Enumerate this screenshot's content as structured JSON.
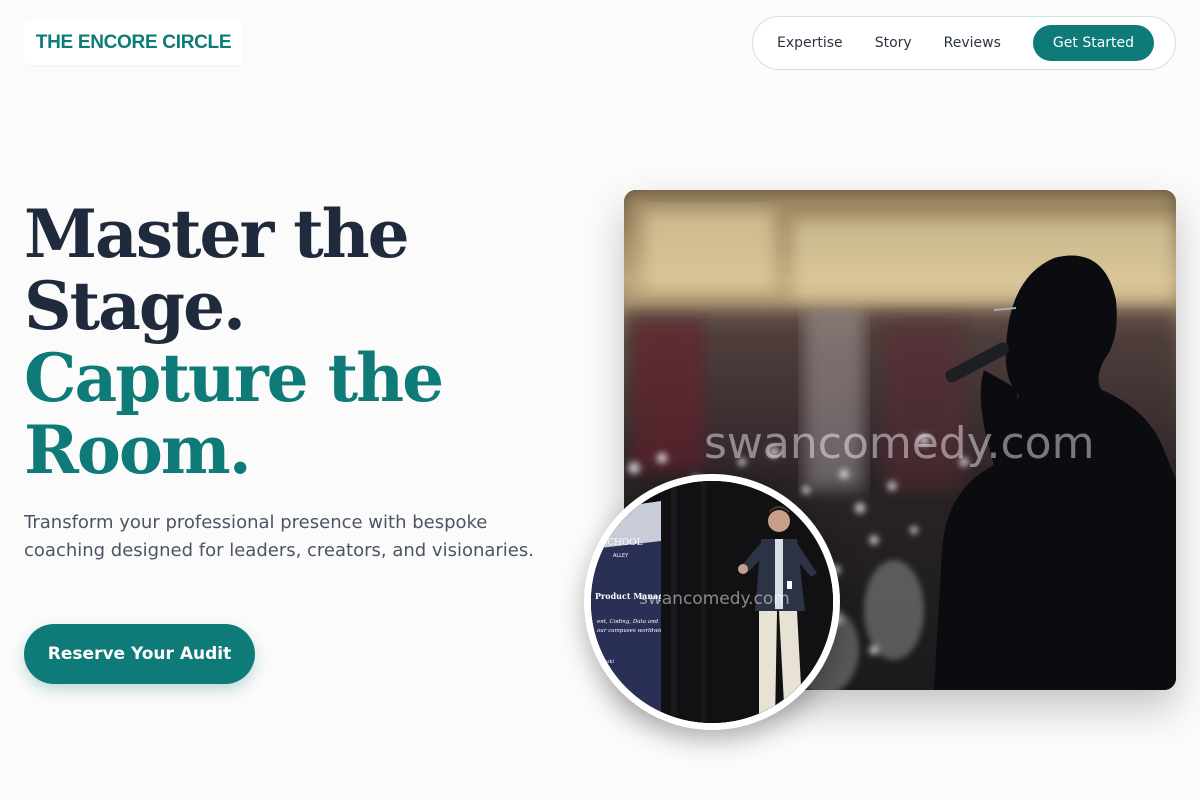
{
  "header": {
    "logo_text": "THE ENCORE CIRCLE",
    "nav": {
      "links": [
        "Expertise",
        "Story",
        "Reviews"
      ],
      "cta_label": "Get Started"
    }
  },
  "hero": {
    "headline_line1": "Master the",
    "headline_line2": "Stage.",
    "headline_line3": "Capture the",
    "headline_line4": "Room.",
    "subtitle": "Transform your professional presence with bespoke coaching designed for leaders, creators, and visionaries.",
    "cta_label": "Reserve Your Audit"
  },
  "media": {
    "main_photo_watermark": "swancomedy.com",
    "inset_photo_watermark": "swancomedy.com",
    "inset_banner_lines": [
      "SCHOOL",
      "ALLEY",
      "Product Manager",
      "ent, Coding, Data and",
      "our campuses worldwide",
      "ework!"
    ]
  },
  "colors": {
    "accent": "#0e7b78",
    "headline_dark": "#1f2a3c",
    "body_text": "#4b5563",
    "background": "#fbfbfb"
  }
}
